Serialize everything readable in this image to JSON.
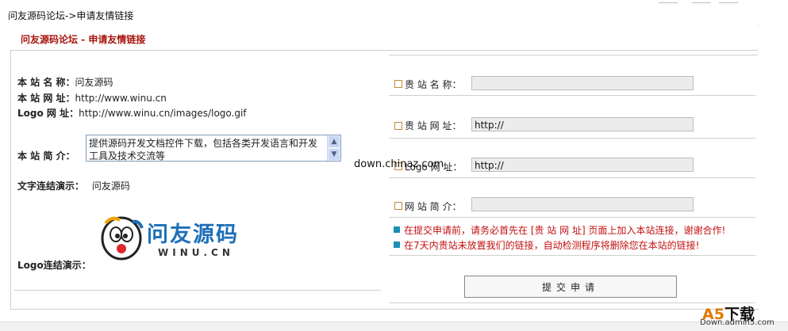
{
  "breadcrumb": {
    "site": "问友源码论坛",
    "sep": "->",
    "current": "申请友情链接"
  },
  "panel": {
    "title": "问友源码论坛 - 申请友情链接"
  },
  "left": {
    "site_name_label": "本 站 名 称：",
    "site_name": "问友源码",
    "site_url_label": "本 站 网 址：",
    "site_url": "http://www.winu.cn",
    "logo_url_label": "Logo 网 址：",
    "logo_url": "http://www.winu.cn/images/logo.gif",
    "intro_label": "本 站 简 介：",
    "intro_text": "提供源码开发文档控件下载，包括各类开发语言和开发工具及技术交流等",
    "text_link_label": "文字连结演示：",
    "text_link_value": "问友源码",
    "logo_link_label": "Logo连结演示：",
    "logo_cn": "问友源码",
    "logo_en": "WINU.CN"
  },
  "right": {
    "fields": [
      {
        "label": "贵 站 名 称：",
        "value": ""
      },
      {
        "label": "贵 站 网 址：",
        "value": "http://"
      },
      {
        "label": "Logo 网 址：",
        "value": "http://"
      },
      {
        "label": "网 站 简 介：",
        "value": ""
      }
    ],
    "notices": [
      "在提交申请前，请务必首先在 [贵 站 网 址] 页面上加入本站连接，谢谢合作!",
      "在7天内贵站未放置我们的链接，自动检测程序将删除您在本站的链接!"
    ],
    "submit_label": "提交申请"
  },
  "overlay": {
    "watermark": "down.chinaz.com",
    "brand_main": "A5",
    "brand_suffix": "下载",
    "brand_url": "Down.admin5.com"
  },
  "colors": {
    "title_red": "#a8140c",
    "notice_red": "#c21010",
    "notice_marker": "#1a8fb3",
    "field_marker": "#c88a3c"
  }
}
